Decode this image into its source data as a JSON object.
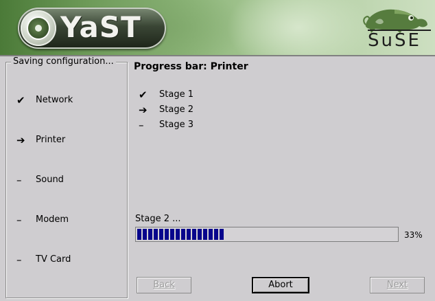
{
  "header": {
    "app_name": "YaST",
    "vendor": "SuSE",
    "colors": {
      "banner_start": "#4b7a38",
      "banner_end": "#cddfc1"
    }
  },
  "sidebar": {
    "title": "Saving configuration...",
    "steps": [
      {
        "label": "Network",
        "status": "done",
        "mark": "✔"
      },
      {
        "label": "Printer",
        "status": "current",
        "mark": "➔"
      },
      {
        "label": "Sound",
        "status": "pending",
        "mark": "–"
      },
      {
        "label": "Modem",
        "status": "pending",
        "mark": "–"
      },
      {
        "label": "TV Card",
        "status": "pending",
        "mark": "–"
      }
    ]
  },
  "main": {
    "heading": "Progress bar: Printer",
    "stages": [
      {
        "label": "Stage 1",
        "status": "done",
        "mark": "✔"
      },
      {
        "label": "Stage 2",
        "status": "current",
        "mark": "➔"
      },
      {
        "label": "Stage 3",
        "status": "pending",
        "mark": "–"
      }
    ],
    "progress": {
      "label": "Stage 2 ...",
      "percent": 33,
      "percent_text": "33%",
      "fill_color": "#07058c"
    }
  },
  "buttons": {
    "back": {
      "label": "Back",
      "enabled": false
    },
    "abort": {
      "label": "Abort",
      "enabled": true
    },
    "next": {
      "label": "Next",
      "enabled": false
    }
  }
}
